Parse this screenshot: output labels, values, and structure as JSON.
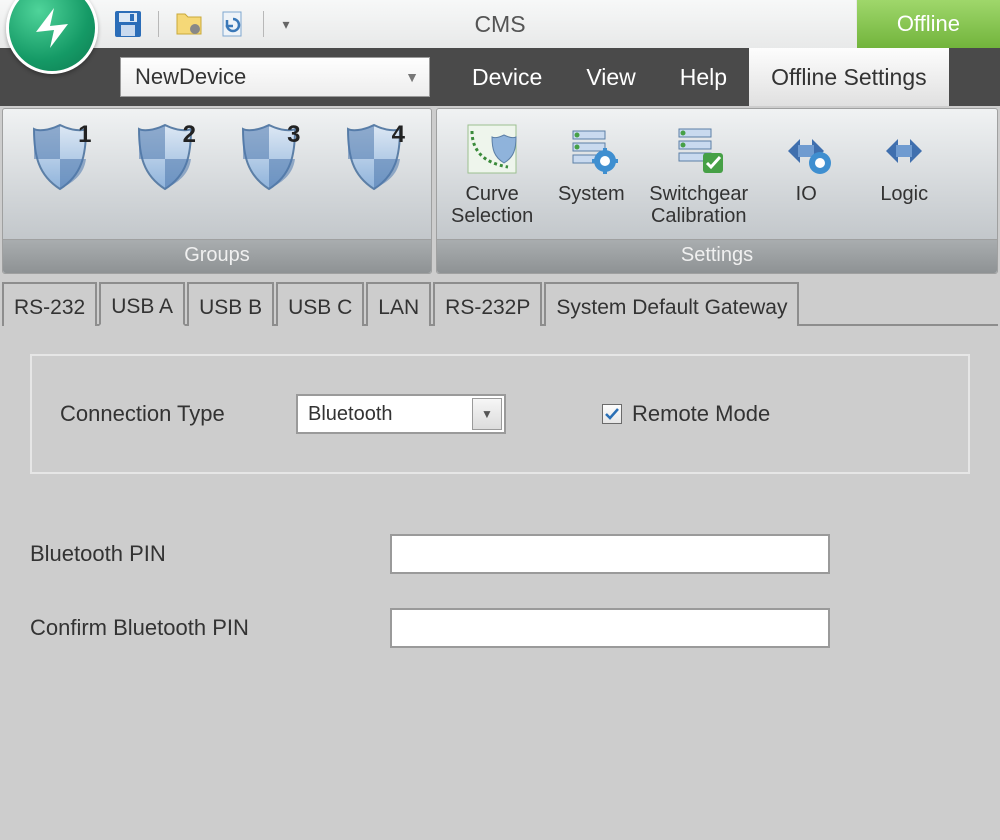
{
  "titlebar": {
    "app_title": "CMS",
    "status": "Offline",
    "qat_dropdown_glyph": "▾"
  },
  "menubar": {
    "device_selected": "NewDevice",
    "items": [
      {
        "label": "Device"
      },
      {
        "label": "View"
      },
      {
        "label": "Help"
      },
      {
        "label": "Offline Settings"
      }
    ],
    "active_index": 3
  },
  "ribbon": {
    "groups_label": "Groups",
    "group_numbers": [
      "1",
      "2",
      "3",
      "4"
    ],
    "settings_label": "Settings",
    "settings_buttons": [
      {
        "label": "Curve\nSelection"
      },
      {
        "label": "System"
      },
      {
        "label": "Switchgear\nCalibration"
      },
      {
        "label": "IO"
      },
      {
        "label": "Logic"
      }
    ]
  },
  "subtabs": {
    "items": [
      "RS-232",
      "USB A",
      "USB B",
      "USB C",
      "LAN",
      "RS-232P",
      "System Default Gateway"
    ],
    "active_index": 1
  },
  "form": {
    "connection_type_label": "Connection Type",
    "connection_type_value": "Bluetooth",
    "remote_mode_label": "Remote Mode",
    "remote_mode_checked": true,
    "bluetooth_pin_label": "Bluetooth PIN",
    "bluetooth_pin_value": "",
    "confirm_pin_label": "Confirm Bluetooth PIN",
    "confirm_pin_value": ""
  }
}
